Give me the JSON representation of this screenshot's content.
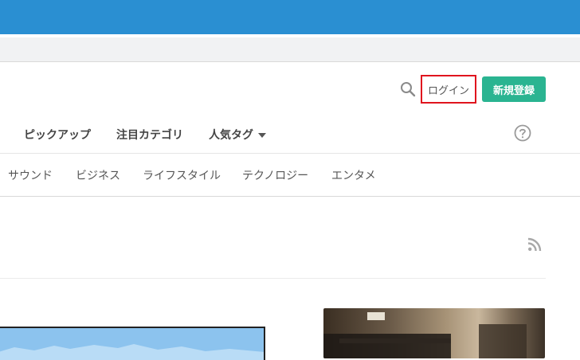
{
  "header": {
    "login_label": "ログイン",
    "signup_label": "新規登録"
  },
  "nav": {
    "items": [
      {
        "label": "ピックアップ"
      },
      {
        "label": "注目カテゴリ"
      },
      {
        "label": "人気タグ"
      }
    ]
  },
  "subnav": {
    "items": [
      {
        "label": "サウンド"
      },
      {
        "label": "ビジネス"
      },
      {
        "label": "ライフスタイル"
      },
      {
        "label": "テクノロジー"
      },
      {
        "label": "エンタメ"
      }
    ]
  },
  "icons": {
    "search": "search-icon",
    "help": "help-icon",
    "rss": "rss-icon",
    "dropdown": "caret-down-icon"
  },
  "colors": {
    "browser_bar": "#2a8fd2",
    "signup": "#2ab491",
    "login_highlight": "#e0141e"
  }
}
